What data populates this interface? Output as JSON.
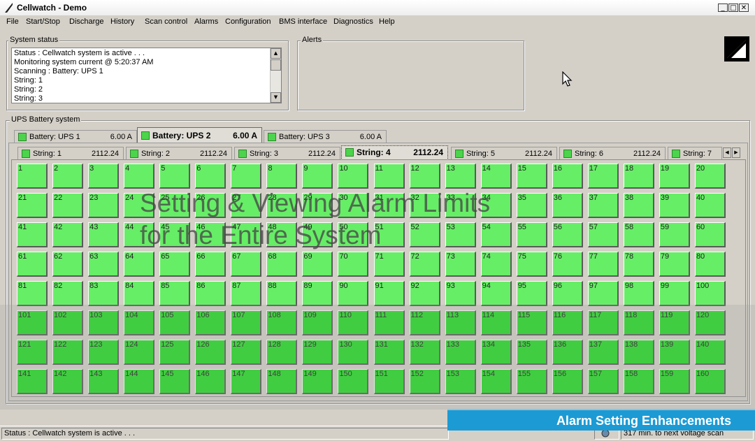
{
  "window": {
    "title": "Cellwatch - Demo"
  },
  "menu": [
    "File",
    "Start/Stop",
    "Discharge",
    "History",
    "Scan control",
    "Alarms",
    "Configuration",
    "BMS interface",
    "Diagnostics",
    "Help"
  ],
  "system_status": {
    "label": "System status",
    "lines": [
      "Status : Cellwatch system is active . . .",
      "Monitoring system current @ 5:20:37 AM",
      "Scanning : Battery: UPS 1",
      "String: 1",
      "String: 2",
      "String: 3"
    ]
  },
  "alerts": {
    "label": "Alerts"
  },
  "ups_panel": {
    "label": "UPS Battery system"
  },
  "battery_tabs": [
    {
      "label": "Battery: UPS 1",
      "current": "6.00 A"
    },
    {
      "label": "Battery: UPS 2",
      "current": "6.00 A"
    },
    {
      "label": "Battery: UPS 3",
      "current": "6.00 A"
    }
  ],
  "active_battery": 1,
  "string_tabs": [
    {
      "label": "String: 1",
      "voltage": "2112.24"
    },
    {
      "label": "String: 2",
      "voltage": "2112.24"
    },
    {
      "label": "String: 3",
      "voltage": "2112.24"
    },
    {
      "label": "String: 4",
      "voltage": "2112.24"
    },
    {
      "label": "String: 5",
      "voltage": "2112.24"
    },
    {
      "label": "String: 6",
      "voltage": "2112.24"
    },
    {
      "label": "String: 7",
      "voltage": ""
    }
  ],
  "active_string": 3,
  "cells": {
    "count": 160,
    "columns": 20,
    "light_color": "#66ee66",
    "bright_color": "#22dd22",
    "bright_from": 101
  },
  "overlay": {
    "line1": "Setting & Viewing Alarm Limits",
    "line2": "for the Entire System"
  },
  "banner": {
    "text": "Alarm Setting Enhancements"
  },
  "statusbar": {
    "status": "Status : Cellwatch system is active . . .",
    "next_scan": "317 min. to next voltage scan"
  }
}
